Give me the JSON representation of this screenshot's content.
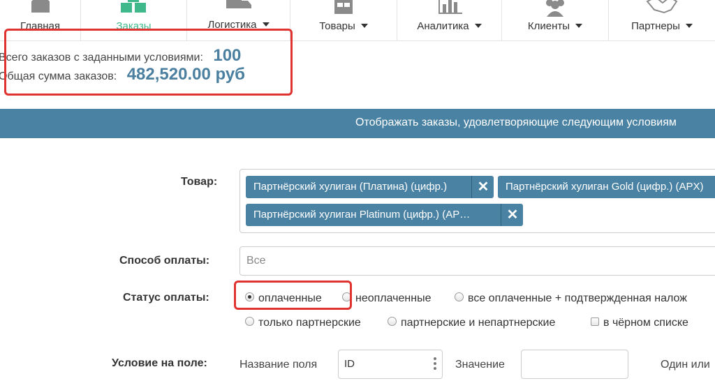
{
  "nav": {
    "items": [
      {
        "label": "Главная",
        "icon": "home-icon",
        "has_caret": false
      },
      {
        "label": "Заказы",
        "icon": "boxes-icon",
        "has_caret": false,
        "active": true
      },
      {
        "label": "Логистика",
        "icon": "truck-icon",
        "has_caret": true
      },
      {
        "label": "Товары",
        "icon": "store-icon",
        "has_caret": true
      },
      {
        "label": "Аналитика",
        "icon": "bar-chart-icon",
        "has_caret": true
      },
      {
        "label": "Клиенты",
        "icon": "users-icon",
        "has_caret": true
      },
      {
        "label": "Партнеры",
        "icon": "handshake-icon",
        "has_caret": true
      }
    ],
    "active_color": "#3fb98c"
  },
  "summary": {
    "total_orders_label": "Всего заказов с заданными условиями:",
    "total_orders_value": "100",
    "total_sum_label": "Общая сумма заказов:",
    "total_sum_value": "482,520.00 руб"
  },
  "banner": {
    "text": "Отображать заказы, удовлетворяющие следующим условиям"
  },
  "form": {
    "product_label": "Товар:",
    "product_tags": [
      "Партнёрский хулиган (Платина) (цифр.)",
      "Партнёрский хулиган Gold (цифр.) (APX)",
      "Партнёрский хулиган Platinum (цифр.) (AP…"
    ],
    "payment_method_label": "Способ оплаты:",
    "payment_method_value": "Все",
    "payment_status_label": "Статус оплаты:",
    "payment_status_options": [
      {
        "label": "оплаченные",
        "checked": true
      },
      {
        "label": "неоплаченные",
        "checked": false
      },
      {
        "label": "все оплаченные + подтвержденная налож",
        "checked": false
      },
      {
        "label": "только партнерские",
        "checked": false
      },
      {
        "label": "партнерские и непартнерские",
        "checked": false
      }
    ],
    "blacklist_label": "в чёрном списке",
    "field_condition_label": "Условие на поле:",
    "field_name_label": "Название поля",
    "field_name_value": "ID",
    "field_value_label": "Значение",
    "field_value_value": "",
    "one_of_label": "Один или"
  },
  "colors": {
    "accent": "#4a82a3",
    "highlight": "#e0322f",
    "value_text": "#4a7fa0"
  }
}
